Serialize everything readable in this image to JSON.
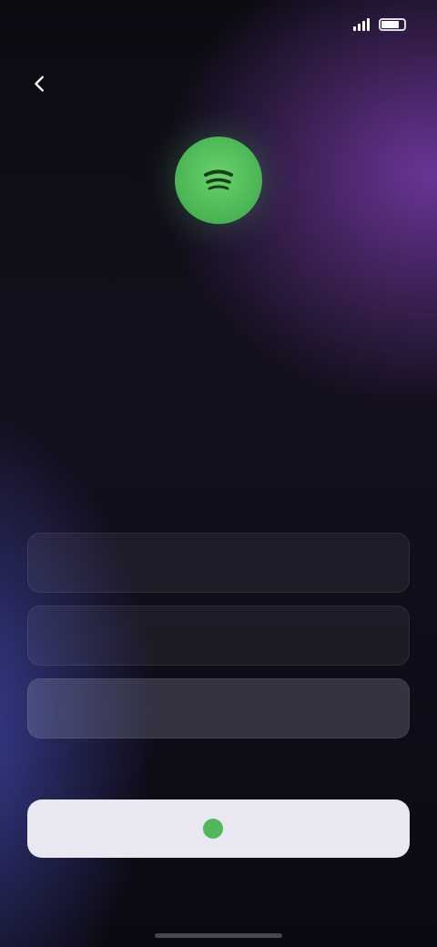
{
  "status_bar": {
    "time": "",
    "center_text": "",
    "battery_level": 0.8,
    "icons": [
      "signal-icon",
      "battery-icon"
    ]
  },
  "header": {
    "back_icon": "chevron-left-icon"
  },
  "brand": {
    "logo_icon": "brand-logo-icon",
    "logo_color": "#4fb85a",
    "wordmark": ""
  },
  "form": {
    "field1_placeholder": "",
    "field2_placeholder": "",
    "field3_placeholder": ""
  },
  "primary_action": {
    "label": "",
    "icon": "brand-icon"
  },
  "footer": {
    "text": ""
  }
}
